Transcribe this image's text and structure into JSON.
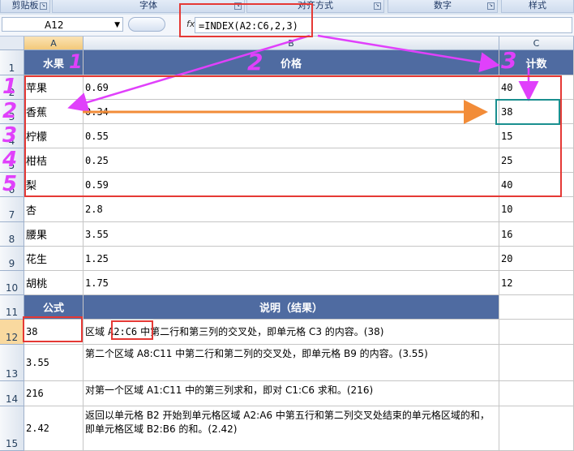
{
  "ribbon": {
    "groups": [
      "剪贴板",
      "字体",
      "对齐方式",
      "数字",
      "样式"
    ]
  },
  "formula_bar": {
    "name_box": "A12",
    "fx_label": "fx",
    "formula": "=INDEX(A2:C6,2,3)"
  },
  "columns": [
    "A",
    "B",
    "C"
  ],
  "row_numbers": [
    "1",
    "2",
    "3",
    "4",
    "5",
    "6",
    "7",
    "8",
    "9",
    "10",
    "11",
    "12",
    "13",
    "14",
    "15"
  ],
  "table": {
    "headers": [
      "水果",
      "价格",
      "计数"
    ],
    "rows": [
      [
        "苹果",
        "0.69",
        "40"
      ],
      [
        "香蕉",
        "0.34",
        "38"
      ],
      [
        "柠檬",
        "0.55",
        "15"
      ],
      [
        "柑桔",
        "0.25",
        "25"
      ],
      [
        "梨",
        "0.59",
        "40"
      ],
      [
        "杏",
        "2.8",
        "10"
      ],
      [
        "腰果",
        "3.55",
        "16"
      ],
      [
        "花生",
        "1.25",
        "20"
      ],
      [
        "胡桃",
        "1.75",
        "12"
      ]
    ]
  },
  "formula_table": {
    "headers": [
      "公式",
      "说明（结果）"
    ],
    "rows": [
      {
        "result": "38",
        "desc_pre": "区域 ",
        "desc_code": "A2:C6",
        "desc_post": " 中第二行和第三列的交叉处，即单元格 C3 的内容。(38)"
      },
      {
        "result": "3.55",
        "desc": "第二个区域 A8:C11 中第二行和第二列的交叉处，即单元格 B9 的内容。(3.55)"
      },
      {
        "result": "216",
        "desc": "对第一个区域 A1:C11 中的第三列求和，即对 C1:C6 求和。(216)"
      },
      {
        "result": "2.42",
        "desc": "返回以单元格 B2 开始到单元格区域 A2:A6 中第五行和第二列交叉处结束的单元格区域的和，即单元格区域 B2:B6 的和。(2.42)"
      }
    ]
  },
  "annotations": {
    "column_numbers": [
      "1",
      "2",
      "3"
    ],
    "row_numbers": [
      "1",
      "2",
      "3",
      "4",
      "5"
    ]
  },
  "colors": {
    "header_fill": "#4f6ba1",
    "annotation_magenta": "#e040fb",
    "highlight_red": "#e53935",
    "arrow_orange": "#f28c38",
    "target_teal": "#1a8f8f"
  }
}
